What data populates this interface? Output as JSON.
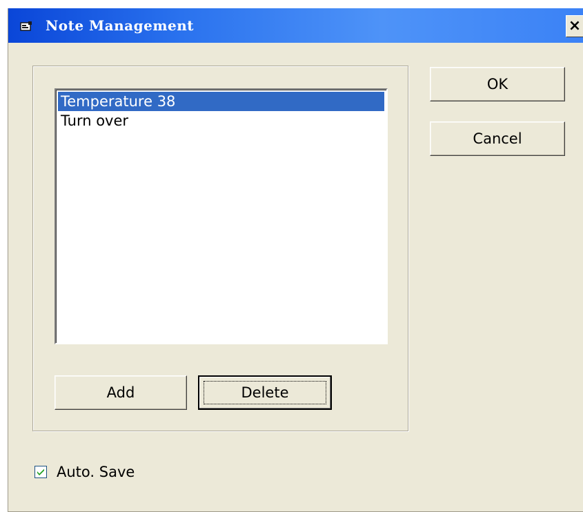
{
  "window": {
    "title": "Note Management",
    "close_label": "×"
  },
  "list": {
    "items": [
      {
        "label": "Temperature 38",
        "selected": true
      },
      {
        "label": "Turn over",
        "selected": false
      }
    ]
  },
  "buttons": {
    "ok": "OK",
    "cancel": "Cancel",
    "add": "Add",
    "delete": "Delete"
  },
  "auto_save": {
    "label": "Auto. Save",
    "checked": true
  },
  "colors": {
    "titlebar_start": "#0a46d8",
    "titlebar_end": "#3b82f6",
    "selection": "#316ac5",
    "dialog_bg": "#ece9d8"
  }
}
